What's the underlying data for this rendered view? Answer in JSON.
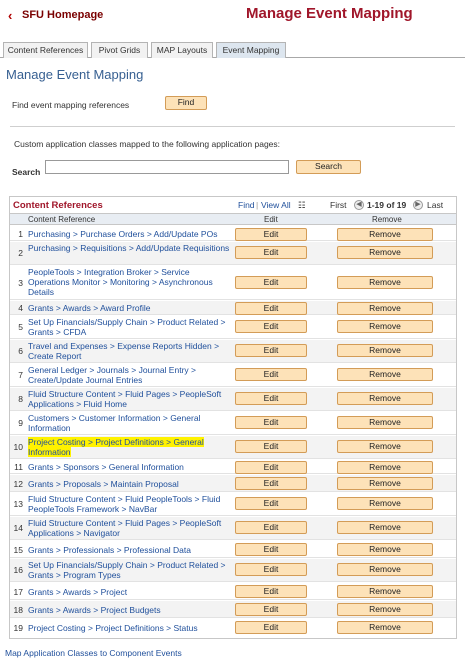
{
  "header": {
    "home_label": "SFU Homepage",
    "title": "Manage Event Mapping"
  },
  "tabs": [
    {
      "label": "Content References",
      "active": false
    },
    {
      "label": "Pivot Grids",
      "active": false
    },
    {
      "label": "MAP Layouts",
      "active": false
    },
    {
      "label": "Event Mapping",
      "active": true
    }
  ],
  "page_title": "Manage Event Mapping",
  "find": {
    "label": "Find event mapping references",
    "button": "Find"
  },
  "info_text": "Custom application classes mapped to the following application pages:",
  "search": {
    "label": "Search",
    "value": "",
    "button": "Search"
  },
  "grid": {
    "title": "Content References",
    "find": "Find",
    "view_all": "View All",
    "first": "First",
    "range": "1-19 of 19",
    "last": "Last",
    "columns": {
      "content_reference": "Content Reference",
      "edit": "Edit",
      "remove": "Remove"
    },
    "edit_label": "Edit",
    "remove_label": "Remove",
    "rows": [
      {
        "num": "1",
        "ref": "Purchasing > Purchase Orders > Add/Update POs"
      },
      {
        "num": "2",
        "ref": "Purchasing > Requisitions > Add/Update Requisitions"
      },
      {
        "num": "3",
        "ref": "PeopleTools > Integration Broker > Service Operations Monitor > Monitoring > Asynchronous Details"
      },
      {
        "num": "4",
        "ref": "Grants > Awards > Award Profile"
      },
      {
        "num": "5",
        "ref": "Set Up Financials/Supply Chain > Product Related > Grants > CFDA"
      },
      {
        "num": "6",
        "ref": "Travel and Expenses > Expense Reports Hidden > Create Report"
      },
      {
        "num": "7",
        "ref": "General Ledger > Journals > Journal Entry > Create/Update Journal Entries"
      },
      {
        "num": "8",
        "ref": "Fluid Structure Content > Fluid Pages > PeopleSoft Applications > Fluid Home"
      },
      {
        "num": "9",
        "ref": "Customers > Customer Information > General Information"
      },
      {
        "num": "10",
        "ref": "Project Costing > Project Definitions > General Information"
      },
      {
        "num": "11",
        "ref": "Grants > Sponsors > General Information"
      },
      {
        "num": "12",
        "ref": "Grants > Proposals > Maintain Proposal"
      },
      {
        "num": "13",
        "ref": "Fluid Structure Content > Fluid PeopleTools > Fluid PeopleTools Framework > NavBar"
      },
      {
        "num": "14",
        "ref": "Fluid Structure Content > Fluid Pages > PeopleSoft Applications > Navigator"
      },
      {
        "num": "15",
        "ref": "Grants > Professionals > Professional Data"
      },
      {
        "num": "16",
        "ref": "Set Up Financials/Supply Chain > Product Related > Grants > Program Types"
      },
      {
        "num": "17",
        "ref": "Grants > Awards > Project"
      },
      {
        "num": "18",
        "ref": "Grants > Awards > Project Budgets"
      },
      {
        "num": "19",
        "ref": "Project Costing > Project Definitions > Status"
      }
    ]
  },
  "footer_link": "Map Application Classes to Component Events",
  "colors": {
    "title_red": "#a0162a",
    "link_blue": "#1f4f9b",
    "button_fill": "#fde2b8",
    "highlight": "#fff200"
  }
}
